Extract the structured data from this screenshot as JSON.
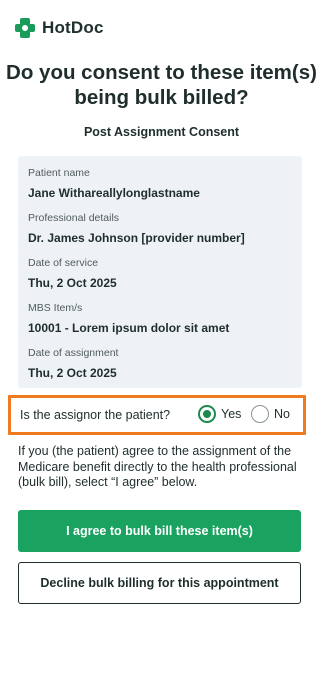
{
  "brand": {
    "name": "HotDoc",
    "color": "#1a9b5a"
  },
  "heading": {
    "title": "Do you consent to these item(s) being bulk billed?",
    "subtitle": "Post Assignment Consent"
  },
  "details": [
    {
      "label": "Patient name",
      "value": "Jane Withareallylonglastname"
    },
    {
      "label": "Professional details",
      "value": "Dr. James Johnson [provider number]"
    },
    {
      "label": "Date of service",
      "value": "Thu, 2 Oct 2025"
    },
    {
      "label": "MBS Item/s",
      "value": "10001 - Lorem ipsum dolor sit amet"
    },
    {
      "label": "Date of assignment",
      "value": "Thu, 2 Oct 2025"
    }
  ],
  "assignor": {
    "question": "Is the assignor the patient?",
    "options": [
      {
        "label": "Yes",
        "selected": true
      },
      {
        "label": "No",
        "selected": false
      }
    ],
    "highlight_color": "#f07a1f"
  },
  "info_text": "If you (the patient) agree to the assignment of the Medicare benefit directly to the health professional (bulk bill), select “I agree” below.",
  "actions": {
    "agree_label": "I agree to bulk bill these item(s)",
    "decline_label": "Decline bulk billing for this appointment",
    "agree_color": "#1aa260"
  }
}
